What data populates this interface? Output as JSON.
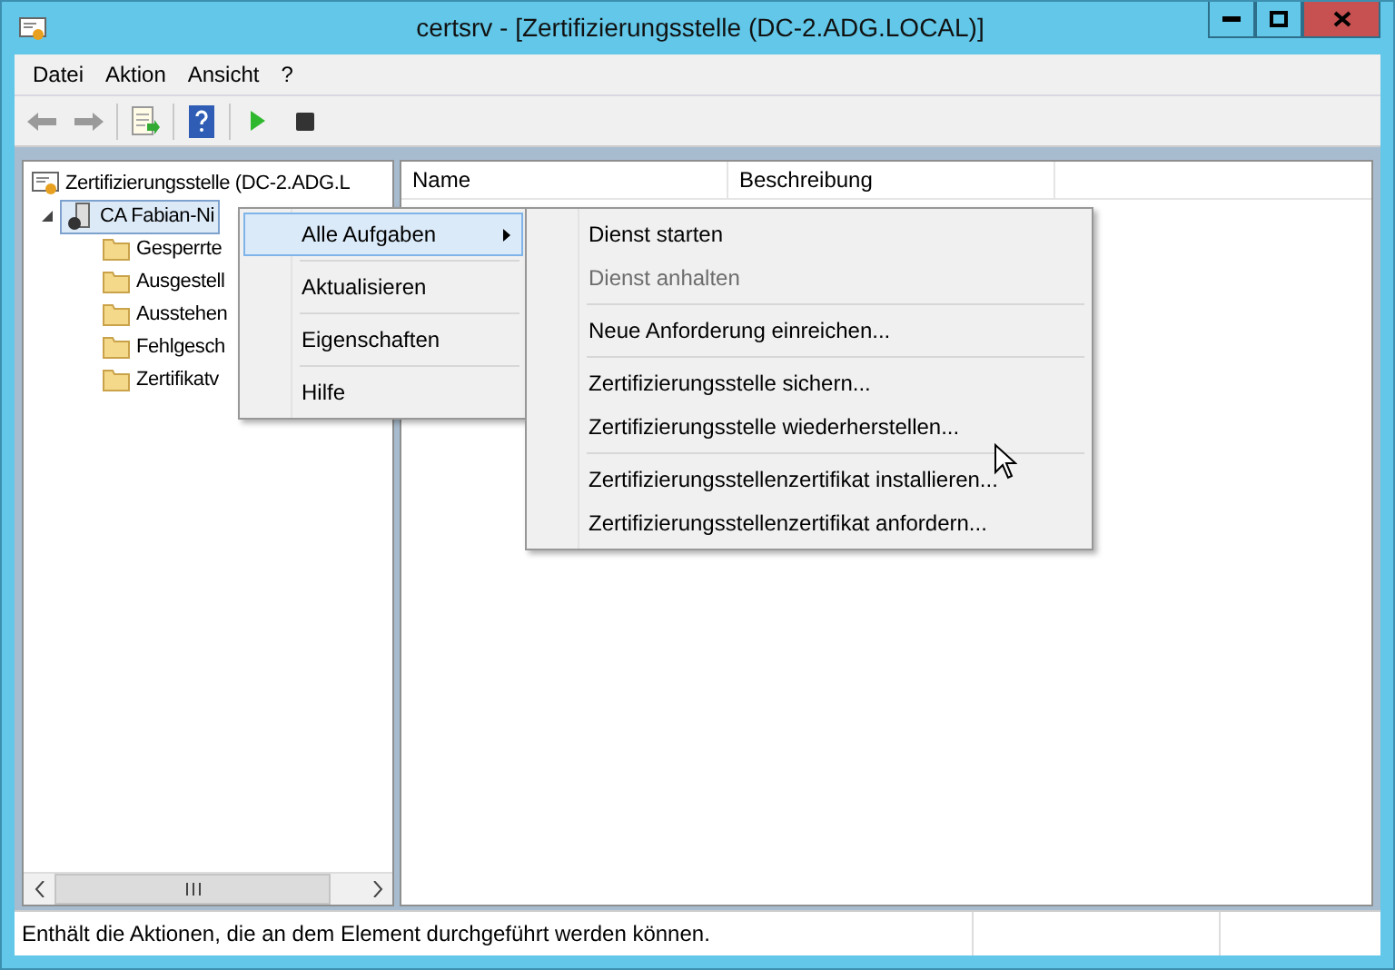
{
  "window": {
    "title": "certsrv - [Zertifizierungsstelle (DC-2.ADG.LOCAL)]"
  },
  "menu_bar": [
    "Datei",
    "Aktion",
    "Ansicht",
    "?"
  ],
  "tree": [
    {
      "label": "Zertifizierungsstelle (DC-2.ADG.L",
      "kind": "root",
      "selected": false,
      "children": [
        {
          "label": "CA Fabian-Ni",
          "kind": "server",
          "selected": true,
          "expanded": true,
          "children": [
            {
              "label": "Gesperrte",
              "kind": "folder",
              "selected": false
            },
            {
              "label": "Ausgestell",
              "kind": "folder",
              "selected": false
            },
            {
              "label": "Ausstehen",
              "kind": "folder",
              "selected": false
            },
            {
              "label": "Fehlgesch",
              "kind": "folder",
              "selected": false
            },
            {
              "label": "Zertifikatv",
              "kind": "folder",
              "selected": false
            }
          ]
        }
      ]
    }
  ],
  "list": {
    "columns": [
      "Name",
      "Beschreibung"
    ]
  },
  "context_menu": [
    {
      "label": "Alle Aufgaben",
      "selected": true,
      "submenu": true
    },
    {
      "label": "Aktualisieren",
      "selected": false,
      "submenu": false
    },
    {
      "label": "Eigenschaften",
      "selected": false,
      "submenu": false
    },
    {
      "label": "Hilfe",
      "selected": false,
      "submenu": false
    }
  ],
  "submenu": [
    [
      {
        "label": "Dienst starten",
        "disabled": false
      },
      {
        "label": "Dienst anhalten",
        "disabled": true
      }
    ],
    [
      {
        "label": "Neue Anforderung einreichen...",
        "disabled": false
      }
    ],
    [
      {
        "label": "Zertifizierungsstelle sichern...",
        "disabled": false
      },
      {
        "label": "Zertifizierungsstelle wiederherstellen...",
        "disabled": false
      }
    ],
    [
      {
        "label": "Zertifizierungsstellenzertifikat installieren...",
        "disabled": false
      },
      {
        "label": "Zertifizierungsstellenzertifikat anfordern...",
        "disabled": false
      }
    ]
  ],
  "status_bar": {
    "text": "Enthält die Aktionen, die an dem Element durchgeführt werden können."
  }
}
